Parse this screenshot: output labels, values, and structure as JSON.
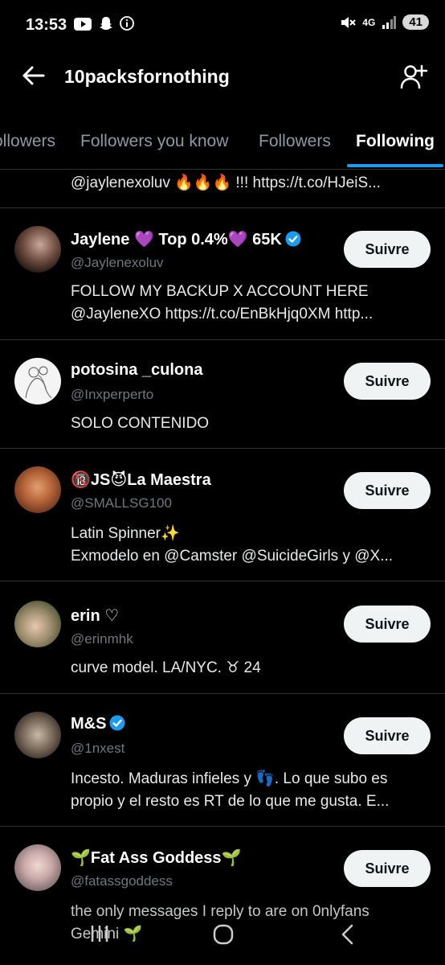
{
  "status_bar": {
    "time": "13:53",
    "network": "4G",
    "battery": "41"
  },
  "header": {
    "title": "10packsfornothing"
  },
  "tabs": [
    {
      "label": "ollowers"
    },
    {
      "label": "Followers you know"
    },
    {
      "label": "Followers"
    },
    {
      "label": "Following"
    }
  ],
  "partial_bio": "@jaylenexoluv 🔥🔥🔥 !!! https://t.co/HJeiS...",
  "users": [
    {
      "name": "Jaylene 💜 Top 0.4%💜 65K",
      "handle": "@Jaylenexoluv",
      "bio1": "FOLLOW MY BACKUP X ACCOUNT HERE",
      "bio2": "@JayleneXO https://t.co/EnBkHjq0XM http...",
      "button": "Suivre"
    },
    {
      "name": "potosina _culona",
      "handle": "@Inxperperto",
      "bio1": "SOLO CONTENIDO",
      "bio2": "",
      "button": "Suivre"
    },
    {
      "name": "🔞JS😈La Maestra",
      "handle": "@SMALLSG100",
      "bio1": "Latin Spinner✨",
      "bio2": "Exmodelo en @Camster @SuicideGirls y @X...",
      "button": "Suivre"
    },
    {
      "name": "erin ♡",
      "handle": "@erinmhk",
      "bio1": "curve model. LA/NYC. ♉ 24",
      "bio2": "",
      "button": "Suivre"
    },
    {
      "name": "M&S",
      "handle": "@1nxest",
      "bio1": "Incesto. Maduras infieles y 👣. Lo que subo es",
      "bio2": "propio y el resto es RT de lo que me gusta. E...",
      "button": "Suivre"
    },
    {
      "name": "🌱Fat Ass Goddess🌱",
      "handle": "@fatassgoddess",
      "bio1": "the only messages I reply to are on 0nlyfans",
      "bio2": "Gemini 🌱",
      "button": "Suivre"
    }
  ]
}
